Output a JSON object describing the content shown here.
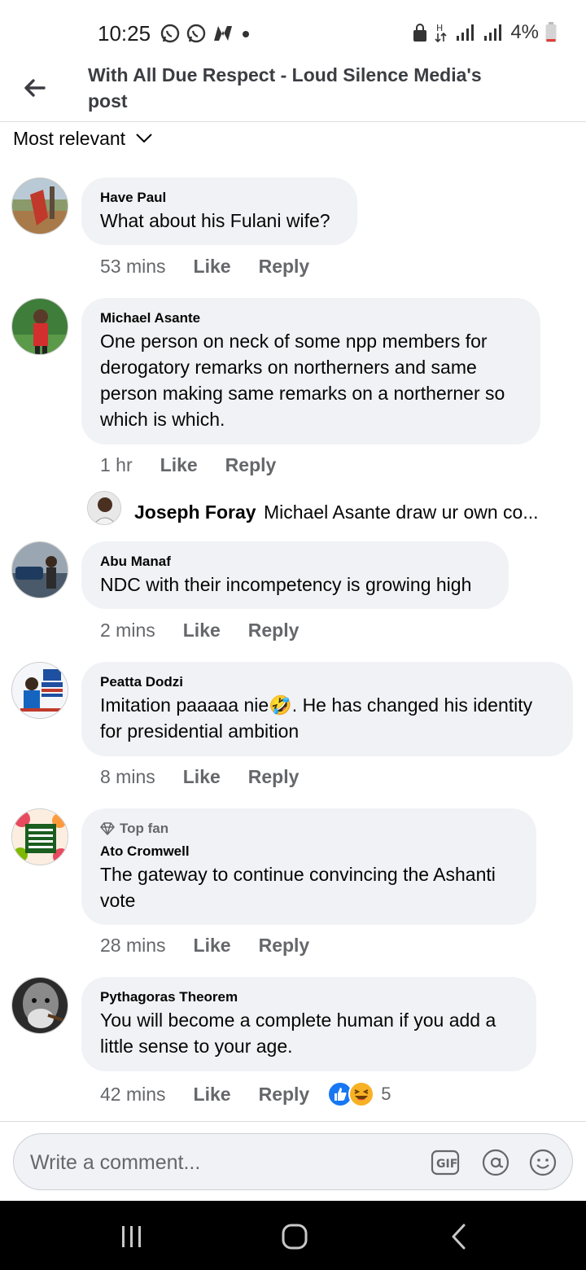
{
  "status": {
    "time": "10:25",
    "battery": "4%"
  },
  "header": {
    "title": "With All Due Respect - Loud Silence Media's post"
  },
  "sort": {
    "label": "Most relevant"
  },
  "comments": [
    {
      "author": "Have Paul",
      "text": "What about his Fulani wife?",
      "time": "53 mins",
      "like": "Like",
      "reply": "Reply"
    },
    {
      "author": "Michael Asante",
      "text": "One person on neck of some npp members for derogatory remarks on northerners and same person making same remarks on a northerner so which is which.",
      "time": "1 hr",
      "like": "Like",
      "reply": "Reply"
    },
    {
      "author": "Abu Manaf",
      "text": "NDC with their incompetency is growing high",
      "time": "2 mins",
      "like": "Like",
      "reply": "Reply"
    },
    {
      "author": "Peatta Dodzi",
      "text": "Imitation paaaaa nie🤣. He has changed his identity for presidential ambition",
      "time": "8 mins",
      "like": "Like",
      "reply": "Reply"
    },
    {
      "badge": "Top fan",
      "author": "Ato Cromwell",
      "text": "The gateway to continue convincing the Ashanti vote",
      "time": "28 mins",
      "like": "Like",
      "reply": "Reply"
    },
    {
      "author": "Pythagoras Theorem",
      "text": "You will become a complete human if you add a little sense to your age.",
      "time": "42 mins",
      "like": "Like",
      "reply": "Reply",
      "reaction_count": "5"
    }
  ],
  "reply_preview": {
    "author": "Joseph Foray",
    "text": "Michael Asante draw ur own co..."
  },
  "composer": {
    "placeholder": "Write a comment..."
  },
  "colors": {
    "bubble": "#f0f2f5",
    "meta": "#65676b",
    "like_blue": "#1877f2",
    "haha_yellow": "#f7b125"
  },
  "icons": [
    "back-arrow-icon",
    "chevron-down-icon",
    "gif-icon",
    "mention-icon",
    "emoji-icon",
    "recents-icon",
    "home-icon",
    "nav-back-icon"
  ]
}
